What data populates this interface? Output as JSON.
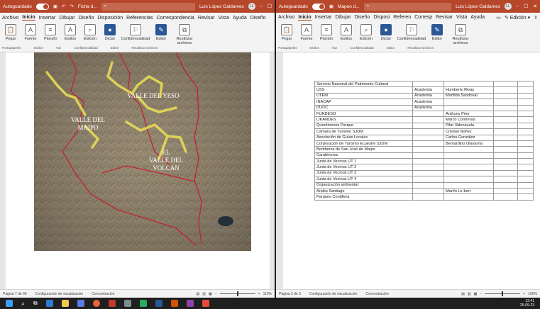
{
  "left_window": {
    "titlebar": {
      "autosave": "Autoguardado",
      "filename": "Ficha d...",
      "user": "Luis López Galdames",
      "avatar": "LL"
    },
    "menu": [
      "Archivo",
      "Inicio",
      "Insertar",
      "Dibujar",
      "Diseño",
      "Disposición",
      "Referencias",
      "Correspondencia",
      "Revisar",
      "Vista",
      "Ayuda",
      "Diseño"
    ],
    "ribbon": {
      "buttons": [
        "Pegar",
        "Fuente",
        "Párrafo",
        "Estilos",
        "Edición",
        "Dictar",
        "Confidencialidad",
        "Editor",
        "Reutilizar archivos"
      ],
      "groups": [
        "Portapapeles",
        "Estilos",
        "Voz",
        "Confidencialidad",
        "Editor",
        "Reutilizar archivos"
      ]
    },
    "map_labels": [
      "VALLE DEL MAIPO",
      "VALLE DEL YESO",
      "EL VALLE DEL VOLCAN"
    ],
    "status": {
      "page": "Página 7 de 66",
      "view": "Configuración de visualización",
      "focus": "Concentración",
      "zoom": "110%"
    }
  },
  "right_window": {
    "titlebar": {
      "autosave": "Autoguardado",
      "filename": "Mapeo d...",
      "user": "Luis López Galdames",
      "avatar": "LL"
    },
    "menu": [
      "Archivo",
      "Inicio",
      "Insertar",
      "Dibujar",
      "Diseño",
      "Disposi",
      "Referen",
      "Corresp",
      "Revisar",
      "Vista",
      "Ayuda"
    ],
    "menu_right": "Edición",
    "ribbon": {
      "buttons": [
        "Pegar",
        "Fuente",
        "Párrafo",
        "Estilos",
        "Edición",
        "Dictar",
        "Confidencialidad",
        "Editor",
        "Reutilizar archivos"
      ],
      "groups": [
        "Portapapeles",
        "Estilos",
        "Voz",
        "Confidencialidad",
        "Editor",
        "Reutilizar archivos"
      ]
    },
    "table_rows": [
      [
        "Servicio Nacional del Patrimonio Cultural",
        "",
        "",
        "",
        ""
      ],
      [
        "USS",
        "Academia",
        "Humberto Rivas",
        "",
        ""
      ],
      [
        "UTEM",
        "Academia",
        "Marfilda Sandoval",
        "",
        ""
      ],
      [
        "INACAP",
        "Academia",
        "",
        "",
        ""
      ],
      [
        "DUOC",
        "Academia",
        "",
        "",
        ""
      ],
      [
        "FUNDESO",
        "",
        "Anthony Prior",
        "",
        ""
      ],
      [
        "LIKANDES",
        "",
        "Marco Contreras",
        "",
        ""
      ],
      [
        "Querómenos Parque",
        "",
        "Pilar Valenzuela",
        "",
        ""
      ],
      [
        "Cámara de Turismo SJDM",
        "",
        "Cristian Núñez",
        "",
        ""
      ],
      [
        "Asociación de Guías Locales",
        "",
        "Carlos González",
        "",
        ""
      ],
      [
        "Corporación de Turismo Ecuestre SJDM",
        "",
        "Bernardino Olavarría",
        "",
        ""
      ],
      [
        "Bomberos de San José de Maipo",
        "",
        "",
        "",
        ""
      ],
      [
        "Carabineros",
        "",
        "",
        "",
        ""
      ],
      [
        "Junta de Vecinos UT 1",
        "",
        "",
        "",
        ""
      ],
      [
        "Junta de Vecinos UT 2",
        "",
        "",
        "",
        ""
      ],
      [
        "Junta de Vecinos UT 3",
        "",
        "",
        "",
        ""
      ],
      [
        "Junta de Vecinos UT 4",
        "",
        "",
        "",
        ""
      ],
      [
        "Organización ambiental",
        "",
        "",
        "",
        ""
      ],
      [
        "Andes Santiago",
        "",
        "Martín Le-bert",
        "",
        ""
      ],
      [
        "Parques Cordillera",
        "",
        "",
        "",
        ""
      ]
    ],
    "status": {
      "page": "Página 2 de 3",
      "view": "Configuración de visualización",
      "focus": "Concentración",
      "zoom": "100%"
    }
  },
  "taskbar": {
    "time": "12:41",
    "date": "25-09-23"
  }
}
